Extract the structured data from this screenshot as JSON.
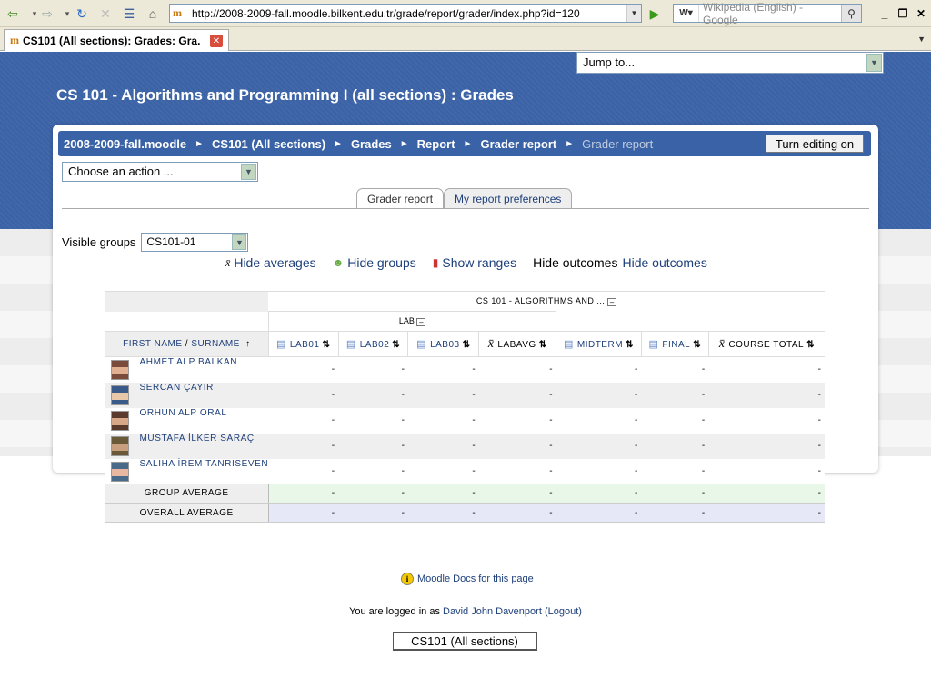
{
  "browser": {
    "url": "http://2008-2009-fall.moodle.bilkent.edu.tr/grade/report/grader/index.php?id=120",
    "search_placeholder": "Wikipedia (English) - Google",
    "tab_title": "CS101 (All sections): Grades: Gra..."
  },
  "page": {
    "jump_to": "Jump to...",
    "course_heading": "CS 101 - Algorithms and Programming I (all sections) : Grades",
    "breadcrumbs": [
      "2008-2009-fall.moodle",
      "CS101 (All sections)",
      "Grades",
      "Report",
      "Grader report",
      "Grader report"
    ],
    "edit_button": "Turn editing on",
    "action_select": "Choose an action ...",
    "report_tabs": [
      "Grader report",
      "My report preferences"
    ],
    "visible_groups_label": "Visible groups",
    "visible_groups_value": "CS101-01",
    "toggles": {
      "hide_averages": "Hide averages",
      "hide_groups": "Hide groups",
      "show_ranges": "Show ranges",
      "hide_outcomes_label": "Hide outcomes",
      "hide_outcomes_link": "Hide outcomes"
    }
  },
  "grader": {
    "course_category": "CS 101 - ALGORITHMS AND ...",
    "lab_category": "LAB",
    "name_header_first": "FIRST NAME",
    "name_header_sep": "/",
    "name_header_last": "SURNAME",
    "columns": [
      "LAB01",
      "LAB02",
      "LAB03",
      "LABAVG",
      "MIDTERM",
      "FINAL",
      "COURSE TOTAL"
    ],
    "students": [
      {
        "name": "AHMET ALP BALKAN",
        "grades": [
          "-",
          "-",
          "-",
          "-",
          "-",
          "-",
          "-"
        ]
      },
      {
        "name": "SERCAN ÇAYIR",
        "grades": [
          "-",
          "-",
          "-",
          "-",
          "-",
          "-",
          "-"
        ]
      },
      {
        "name": "ORHUN ALP ORAL",
        "grades": [
          "-",
          "-",
          "-",
          "-",
          "-",
          "-",
          "-"
        ]
      },
      {
        "name": "MUSTAFA İLKER SARAÇ",
        "grades": [
          "-",
          "-",
          "-",
          "-",
          "-",
          "-",
          "-"
        ]
      },
      {
        "name": "SALIHA İREM TANRISEVEN",
        "grades": [
          "-",
          "-",
          "-",
          "-",
          "-",
          "-",
          "-"
        ]
      }
    ],
    "group_average_label": "GROUP AVERAGE",
    "group_average": [
      "-",
      "-",
      "-",
      "-",
      "-",
      "-",
      "-"
    ],
    "overall_average_label": "OVERALL AVERAGE",
    "overall_average": [
      "-",
      "-",
      "-",
      "-",
      "-",
      "-",
      "-"
    ]
  },
  "footer": {
    "docs_link": "Moodle Docs for this page",
    "logged_in_prefix": "You are logged in as",
    "user_name": "David John Davenport",
    "logout": "(Logout)",
    "course_button": "CS101 (All sections)"
  },
  "colors": {
    "banner": "#3a62a6",
    "link": "#1d3f7a",
    "group_avg_bg": "#e9f7e9",
    "overall_avg_bg": "#e6e8f7"
  }
}
